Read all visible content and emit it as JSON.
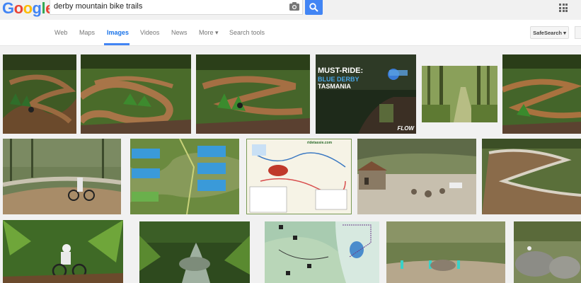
{
  "logo": {
    "letters": [
      "G",
      "o",
      "o",
      "g",
      "l",
      "e"
    ],
    "colors": [
      "#4285f4",
      "#ea4335",
      "#fbbc05",
      "#4285f4",
      "#34a853",
      "#ea4335"
    ]
  },
  "search": {
    "query": "derby mountain bike trails"
  },
  "nav": {
    "tabs": [
      {
        "label": "Web"
      },
      {
        "label": "Maps"
      },
      {
        "label": "Images"
      },
      {
        "label": "Videos"
      },
      {
        "label": "News"
      },
      {
        "label": "More ▾"
      },
      {
        "label": "Search tools"
      }
    ],
    "active_tab": "Images",
    "safesearch_label": "SafeSearch ▾"
  },
  "results": {
    "thumb_3_overlay": {
      "line1": "MUST-RIDE:",
      "line2": "BLUE DERBY",
      "line3": "TASMANIA",
      "badge": "FLOW"
    },
    "thumb_8_header": "ridetassie.com"
  },
  "colors": {
    "accent": "#4285f4",
    "background": "#f1f1f1"
  }
}
